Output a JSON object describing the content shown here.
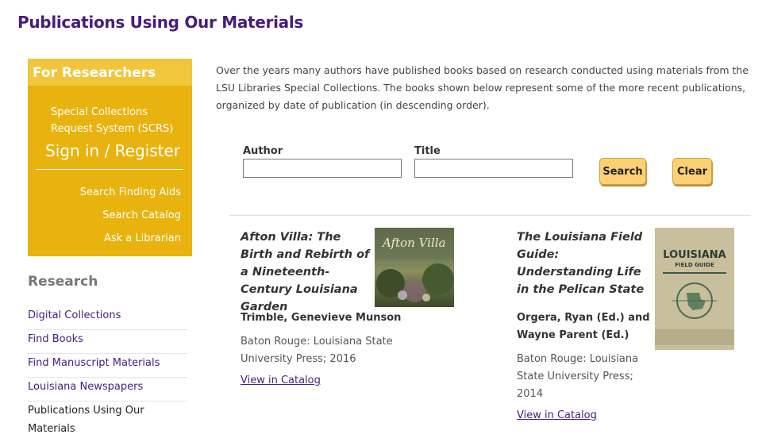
{
  "page": {
    "title": "Publications Using Our Materials"
  },
  "sidebar": {
    "box": {
      "heading": "For Researchers",
      "scrs": "Special Collections Request System (SCRS)",
      "sign_in": "Sign in / Register",
      "links": [
        "Search Finding Aids",
        "Search Catalog",
        "Ask a Librarian"
      ]
    },
    "research_heading": "Research",
    "nav": [
      "Digital Collections",
      "Find Books",
      "Find Manuscript Materials",
      "Louisiana Newspapers",
      "Publications Using Our Materials"
    ]
  },
  "main": {
    "intro": "Over the years many authors have published books based on research conducted using materials from the LSU Libraries Special Collections. The books shown below represent some of the more recent publications, organized by date of publication (in descending order).",
    "search": {
      "author_label": "Author",
      "title_label": "Title",
      "author_value": "",
      "title_value": "",
      "search_button": "Search",
      "clear_button": "Clear"
    },
    "books": [
      {
        "title": "Afton Villa: The Birth and Rebirth of a Nineteenth-Century Louisiana Garden",
        "author": "Trimble, Genevieve Munson",
        "publisher": "Baton Rouge: Louisiana State University Press; 2016",
        "link": "View in Catalog",
        "cover_text": "Afton Villa"
      },
      {
        "title": "The Louisiana Field Guide: Understanding Life in the Pelican State",
        "author": "Orgera, Ryan (Ed.) and Wayne Parent (Ed.)",
        "publisher": "Baton Rouge: Louisiana State University Press; 2014",
        "link": "View in Catalog",
        "cover_text": "LOUISIANA",
        "cover_subtext": "FIELD GUIDE"
      }
    ]
  },
  "colors": {
    "brand_purple": "#461d7c",
    "sidebar_gold": "#e8b30e",
    "sidebar_header": "#f1c63d",
    "button_gold": "#fdd074"
  }
}
